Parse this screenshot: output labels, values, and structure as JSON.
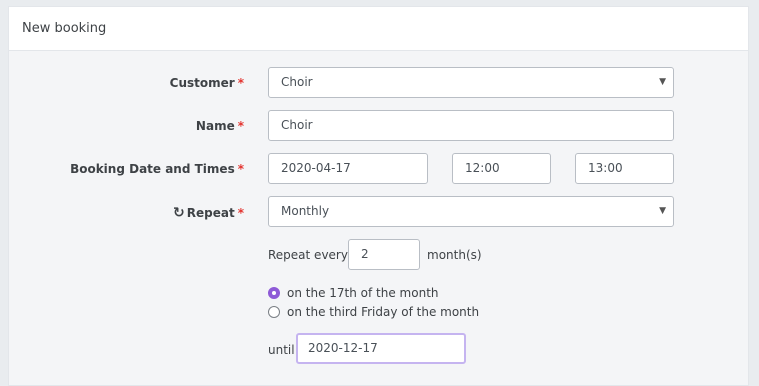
{
  "card": {
    "title": "New booking"
  },
  "form": {
    "required_mark": "*",
    "customer": {
      "label": "Customer",
      "value": "Choir"
    },
    "name": {
      "label": "Name",
      "value": "Choir"
    },
    "booking": {
      "label": "Booking Date and Times",
      "date": "2020-04-17",
      "start_time": "12:00",
      "end_time": "13:00"
    },
    "repeat": {
      "label": "Repeat",
      "icon": "refresh-icon",
      "value": "Monthly",
      "every_label": "Repeat every",
      "every_value": "2",
      "every_unit": "month(s)",
      "options": [
        {
          "label": "on the 17th of the month",
          "selected": true
        },
        {
          "label": "on the third Friday of the month",
          "selected": false
        }
      ],
      "until_label": "until",
      "until_value": "2020-12-17"
    }
  },
  "colors": {
    "accent": "#8e5ad7",
    "required": "#e3342f",
    "focus": "#c5b4f0"
  }
}
